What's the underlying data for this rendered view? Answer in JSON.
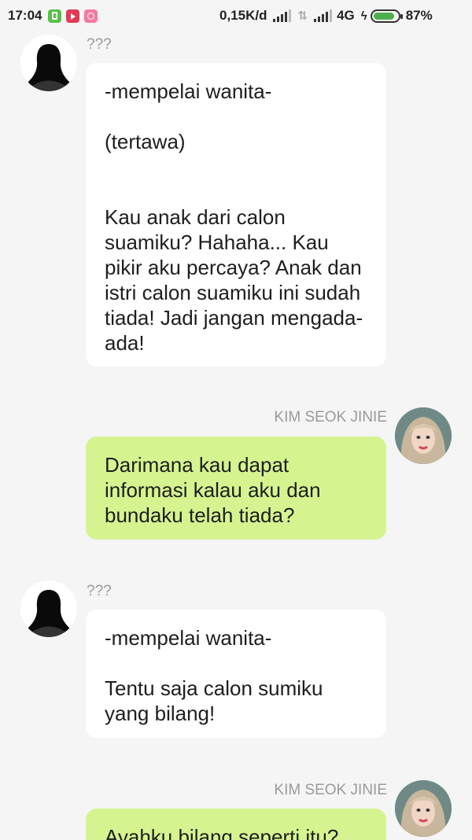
{
  "status_bar": {
    "time": "17:04",
    "network_speed": "0,15K/d",
    "network_type": "4G",
    "battery": "87%",
    "battery_level": 0.87
  },
  "colors": {
    "background": "#f5f5f5",
    "incoming_bubble": "#ffffff",
    "outgoing_bubble": "#d5f490",
    "name_text": "#9a9a9a"
  },
  "chat": {
    "messages": [
      {
        "sender": "???",
        "side": "left",
        "text": "-mempelai wanita-\n\n(tertawa)\n\n\nKau anak dari calon suamiku? Hahaha... Kau pikir aku percaya? Anak dan istri calon suamiku ini sudah tiada! Jadi jangan mengada-ada!"
      },
      {
        "sender": "KIM SEOK JINIE",
        "side": "right",
        "text": "Darimana kau dapat informasi kalau aku dan bundaku telah tiada?"
      },
      {
        "sender": "???",
        "side": "left",
        "text": "-mempelai wanita-\n\nTentu saja calon sumiku yang bilang!"
      },
      {
        "sender": "KIM SEOK JINIE",
        "side": "right",
        "text": "Ayahku bilang seperti itu?"
      }
    ]
  }
}
